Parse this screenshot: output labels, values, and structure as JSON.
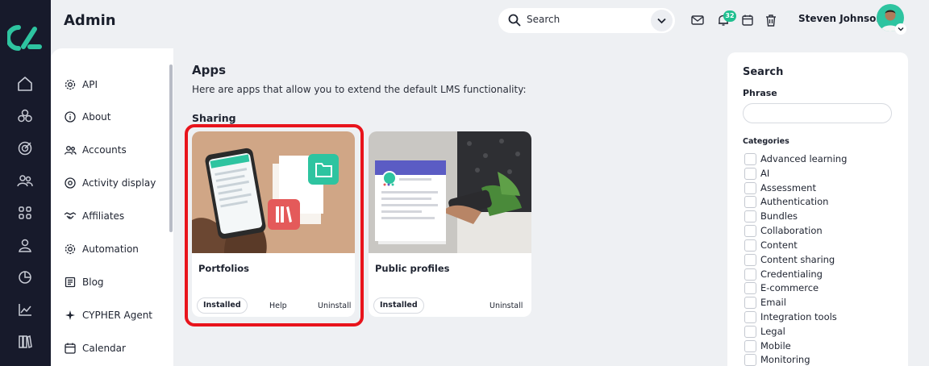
{
  "header": {
    "title": "Admin",
    "search_text": "Search",
    "notification_count": "32",
    "user_name": "Steven Johnson"
  },
  "menu": {
    "items": [
      {
        "label": "API",
        "icon": "gear-icon"
      },
      {
        "label": "About",
        "icon": "info-icon"
      },
      {
        "label": "Accounts",
        "icon": "users-icon"
      },
      {
        "label": "Activity display",
        "icon": "circle-dot-icon"
      },
      {
        "label": "Affiliates",
        "icon": "handshake-icon"
      },
      {
        "label": "Automation",
        "icon": "gear-icon"
      },
      {
        "label": "Blog",
        "icon": "blog-icon"
      },
      {
        "label": "CYPHER Agent",
        "icon": "sparkle-icon"
      },
      {
        "label": "Calendar",
        "icon": "calendar-icon"
      }
    ]
  },
  "main": {
    "title": "Apps",
    "description": "Here are apps that allow you to extend the default LMS functionality:",
    "section_title": "Sharing",
    "cards": [
      {
        "title": "Portfolios",
        "status": "Installed",
        "help": "Help",
        "uninstall": "Uninstall"
      },
      {
        "title": "Public profiles",
        "status": "Installed",
        "uninstall": "Uninstall"
      }
    ]
  },
  "filter_panel": {
    "title": "Search",
    "phrase_label": "Phrase",
    "phrase_value": "",
    "categories_label": "Categories",
    "categories": [
      "Advanced learning",
      "AI",
      "Assessment",
      "Authentication",
      "Bundles",
      "Collaboration",
      "Content",
      "Content sharing",
      "Credentialing",
      "E-commerce",
      "Email",
      "Integration tools",
      "Legal",
      "Mobile",
      "Monitoring"
    ]
  },
  "colors": {
    "rail": "#171a2b",
    "accent": "#1fbf8f",
    "highlight": "#e8141c"
  }
}
